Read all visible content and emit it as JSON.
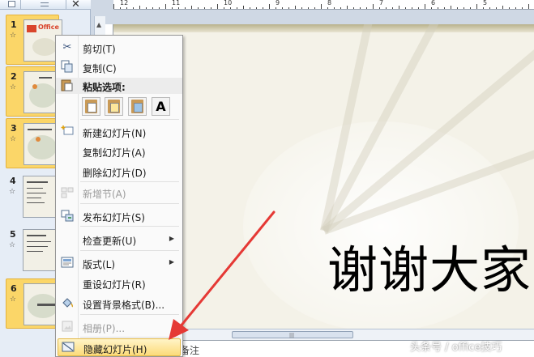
{
  "thumbnails": [
    {
      "number": "1",
      "star": "☆",
      "selected": true
    },
    {
      "number": "2",
      "star": "☆",
      "selected": true
    },
    {
      "number": "3",
      "star": "☆",
      "selected": true
    },
    {
      "number": "4",
      "star": "☆",
      "selected": false
    },
    {
      "number": "5",
      "star": "☆",
      "selected": false
    },
    {
      "number": "6",
      "star": "☆",
      "selected": true
    }
  ],
  "thumb1_text": "Office",
  "pane_close": "✕",
  "ruler_labels": [
    "12",
    "11",
    "10",
    "9",
    "8",
    "7",
    "6",
    "5"
  ],
  "slide": {
    "title": "谢谢大家"
  },
  "notes_text": "备注",
  "watermark": "头条号 / office技巧",
  "context_menu": {
    "cut": "剪切(T)",
    "copy": "复制(C)",
    "paste_options": "粘贴选项:",
    "paste_text_option": "A",
    "new_slide": "新建幻灯片(N)",
    "duplicate_slide": "复制幻灯片(A)",
    "delete_slide": "删除幻灯片(D)",
    "new_section": "新增节(A)",
    "publish_slides": "发布幻灯片(S)",
    "check_updates": "检查更新(U)",
    "layout": "版式(L)",
    "reset_slide": "重设幻灯片(R)",
    "format_background": "设置背景格式(B)...",
    "photo_album": "相册(P)...",
    "hide_slide": "隐藏幻灯片(H)"
  },
  "colors": {
    "selection": "#fbd668",
    "arrow": "#e53935",
    "menu_highlight": "#fcdb7a"
  }
}
